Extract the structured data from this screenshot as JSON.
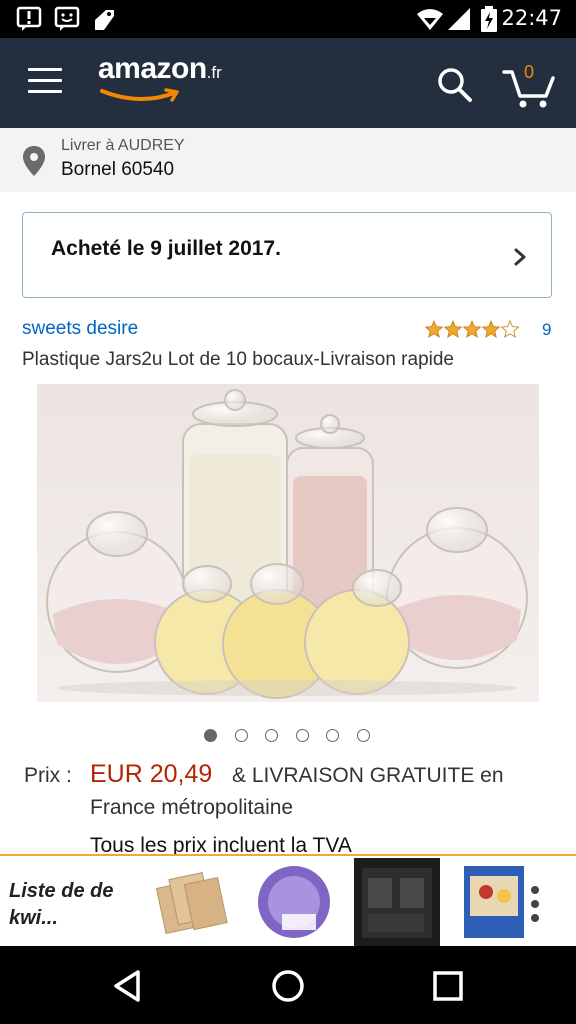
{
  "status_bar": {
    "time": "22:47"
  },
  "header": {
    "logo_main": "amazon",
    "logo_tld": ".fr",
    "cart_count": "0"
  },
  "address": {
    "line1": "Livrer à AUDREY",
    "line2": "Bornel 60540"
  },
  "purchase_notice": {
    "text": "Acheté le 9 juillet 2017."
  },
  "product": {
    "seller": "sweets desire",
    "rating": 4.5,
    "rating_count": "9",
    "title": "Plastique Jars2u Lot de 10 bocaux-Livraison rapide",
    "image_count": 6,
    "image_active_index": 0
  },
  "price": {
    "label": "Prix :",
    "value": "EUR 20,49",
    "delivery_line1": "& LIVRAISON GRATUITE en",
    "delivery_line2": "France métropolitaine",
    "vat_note": "Tous les prix incluent la TVA"
  },
  "wishlist": {
    "label": "Liste de de kwi..."
  },
  "colors": {
    "header_bg": "#232f3e",
    "price": "#b12704",
    "link": "#0066c0",
    "star": "#f0a830",
    "accent": "#f08804"
  }
}
